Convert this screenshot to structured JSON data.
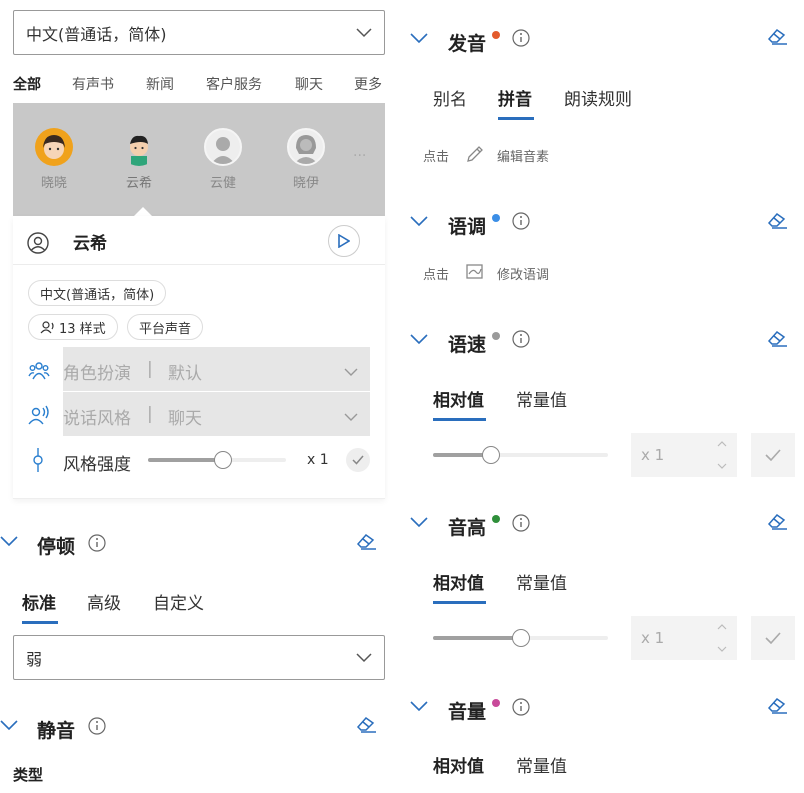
{
  "left": {
    "language_dropdown": "中文(普通话，简体)",
    "categories": [
      "全部",
      "有声书",
      "新闻",
      "客户服务",
      "聊天",
      "更多"
    ],
    "voices": [
      {
        "name": "晓晓",
        "style": "female-orange"
      },
      {
        "name": "云希",
        "style": "male"
      },
      {
        "name": "云健",
        "style": "gray-male"
      },
      {
        "name": "晓伊",
        "style": "gray-female"
      }
    ],
    "more_voices": "···",
    "selected_voice": {
      "name": "云希",
      "tag_language": "中文(普通话，简体)",
      "tag_styles": "13 样式",
      "tag_platform": "平台声音",
      "role_label": "角色扮演",
      "role_sep": "|",
      "role_value": "默认",
      "style_label": "说话风格",
      "style_sep": "|",
      "style_value": "聊天",
      "strength_label": "风格强度",
      "strength_value": "x 1",
      "strength_level": 0.54
    },
    "pause": {
      "title": "停顿",
      "tabs": [
        "标准",
        "高级",
        "自定义"
      ],
      "dropdown_value": "弱"
    },
    "mute": {
      "title": "静音",
      "type_label": "类型"
    }
  },
  "right": {
    "pronunciation": {
      "title": "发音",
      "dot_color": "#e35b2c",
      "tabs": [
        "别名",
        "拼音",
        "朗读规则"
      ],
      "hint_click": "点击",
      "hint_action": "编辑音素"
    },
    "intonation": {
      "title": "语调",
      "dot_color": "#3b8ee6",
      "hint_click": "点击",
      "hint_action": "修改语调"
    },
    "rate": {
      "title": "语速",
      "dot_color": "#9a9a9a",
      "tabs": [
        "相对值",
        "常量值"
      ],
      "value": "x 1",
      "level": 0.33
    },
    "pitch": {
      "title": "音高",
      "dot_color": "#2f8f3a",
      "tabs": [
        "相对值",
        "常量值"
      ],
      "value": "x 1",
      "level": 0.5
    },
    "volume": {
      "title": "音量",
      "dot_color": "#c84a9a",
      "tabs": [
        "相对值",
        "常量值"
      ]
    }
  },
  "colors": {
    "accent": "#2a6ebd",
    "icon_blue": "#2a7fcf"
  }
}
